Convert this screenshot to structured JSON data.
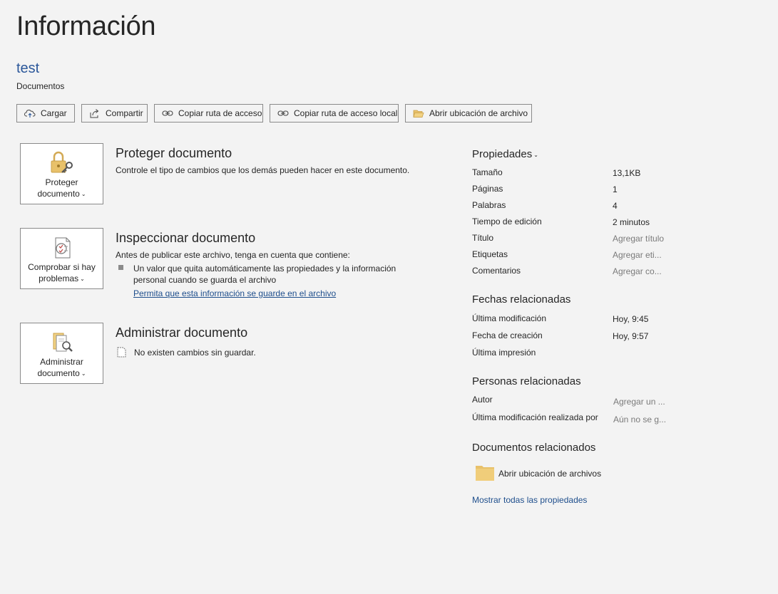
{
  "page": {
    "title": "Información"
  },
  "document": {
    "name": "test",
    "location": "Documentos"
  },
  "actions": {
    "upload": "Cargar",
    "share": "Compartir",
    "copy_path": "Copiar ruta de acceso",
    "copy_local_path": "Copiar ruta de acceso local",
    "open_location": "Abrir ubicación de archivo"
  },
  "protect": {
    "button_line1": "Proteger",
    "button_line2": "documento",
    "title": "Proteger documento",
    "description": "Controle el tipo de cambios que los demás pueden hacer en este documento."
  },
  "inspect": {
    "button_line1": "Comprobar si hay",
    "button_line2": "problemas",
    "title": "Inspeccionar documento",
    "description": "Antes de publicar este archivo, tenga en cuenta que contiene:",
    "item": "Un valor que quita automáticamente las propiedades y la información personal cuando se guarda el archivo",
    "link": "Permita que esta información se guarde en el archivo"
  },
  "manage": {
    "button_line1": "Administrar",
    "button_line2": "documento",
    "title": "Administrar documento",
    "status": "No existen cambios sin guardar."
  },
  "properties": {
    "heading": "Propiedades",
    "size_label": "Tamaño",
    "size_value": "13,1KB",
    "pages_label": "Páginas",
    "pages_value": "1",
    "words_label": "Palabras",
    "words_value": "4",
    "edit_time_label": "Tiempo de edición",
    "edit_time_value": "2 minutos",
    "title_label": "Título",
    "title_value": "Agregar título",
    "tags_label": "Etiquetas",
    "tags_value": "Agregar eti...",
    "comments_label": "Comentarios",
    "comments_value": "Agregar co..."
  },
  "dates": {
    "heading": "Fechas relacionadas",
    "modified_label": "Última modificación",
    "modified_value": "Hoy, 9:45",
    "created_label": "Fecha de creación",
    "created_value": "Hoy, 9:57",
    "printed_label": "Última impresión"
  },
  "people": {
    "heading": "Personas relacionadas",
    "author_label": "Autor",
    "author_value": "Agregar un ...",
    "modified_by_label": "Última modificación realizada por",
    "modified_by_value": "Aún no se g..."
  },
  "related_docs": {
    "heading": "Documentos relacionados",
    "open_location": "Abrir ubicación de archivos"
  },
  "show_all": "Mostrar todas las propiedades",
  "colors": {
    "accent": "#2b579a",
    "link": "#1e4e8c",
    "background": "#f3f3f3",
    "folder": "#e8c16a"
  }
}
